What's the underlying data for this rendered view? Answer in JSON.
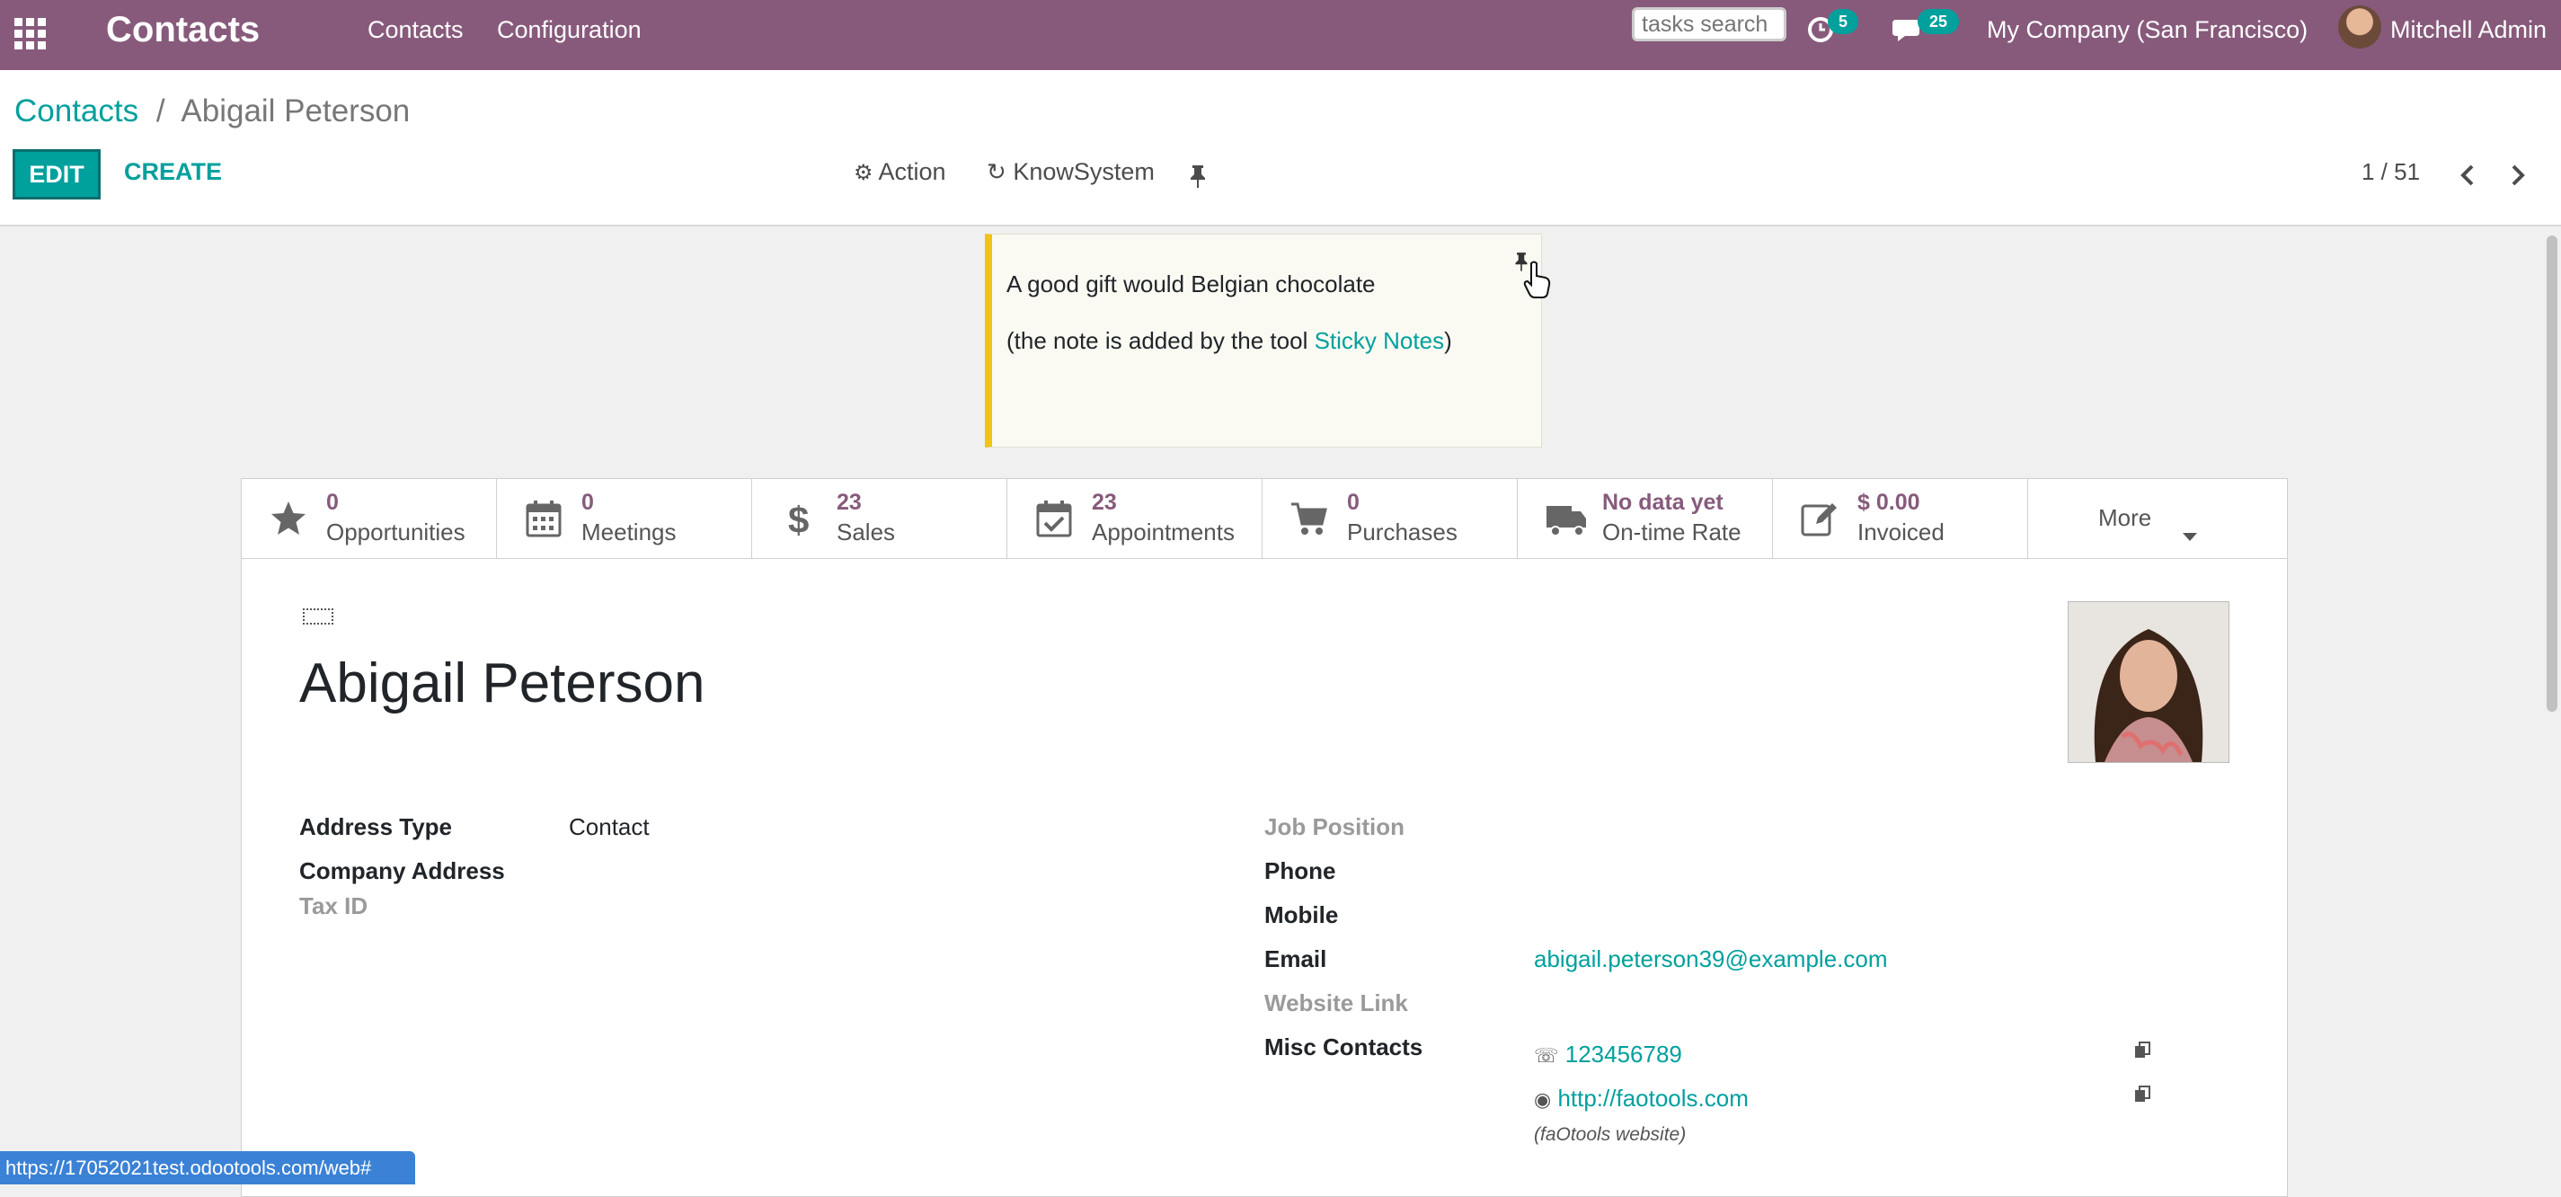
{
  "navbar": {
    "app_title": "Contacts",
    "menu": [
      "Contacts",
      "Configuration"
    ],
    "search_placeholder": "tasks search",
    "activity_count": "5",
    "messages_count": "25",
    "company": "My Company (San Francisco)",
    "user": "Mitchell Admin"
  },
  "breadcrumb": {
    "parent": "Contacts",
    "separator": "/",
    "current": "Abigail Peterson"
  },
  "control_panel": {
    "edit_label": "EDIT",
    "create_label": "CREATE",
    "action_label": "Action",
    "knowsystem_label": "KnowSystem",
    "pager": "1 / 51"
  },
  "sticky_note": {
    "line1": "A good gift would Belgian chocolate",
    "line2_prefix": "(the note is added by the tool ",
    "line2_link": "Sticky Notes",
    "line2_suffix": ")"
  },
  "stat_buttons": [
    {
      "value": "0",
      "label": "Opportunities",
      "icon": "star-icon"
    },
    {
      "value": "0",
      "label": "Meetings",
      "icon": "calendar-icon"
    },
    {
      "value": "23",
      "label": "Sales",
      "icon": "dollar-icon"
    },
    {
      "value": "23",
      "label": "Appointments",
      "icon": "calendar-check-icon"
    },
    {
      "value": "0",
      "label": "Purchases",
      "icon": "cart-icon"
    },
    {
      "value": "No data yet",
      "label": "On-time Rate",
      "icon": "truck-icon"
    },
    {
      "value": "$ 0.00",
      "label": "Invoiced",
      "icon": "edit-icon"
    }
  ],
  "more_label": "More",
  "contact": {
    "name": "Abigail Peterson",
    "left_fields": [
      {
        "label": "Address Type",
        "value": "Contact"
      },
      {
        "label": "Company Address",
        "value": ""
      },
      {
        "label": "Tax ID",
        "value": ""
      }
    ],
    "right_fields": [
      {
        "label": "Job Position",
        "value": ""
      },
      {
        "label": "Phone",
        "value": ""
      },
      {
        "label": "Mobile",
        "value": ""
      },
      {
        "label": "Email",
        "value": "abigail.peterson39@example.com"
      },
      {
        "label": "Website Link",
        "value": ""
      },
      {
        "label": "Misc Contacts",
        "value": ""
      }
    ],
    "misc": [
      {
        "icon": "whatsapp-icon",
        "value": "123456789"
      },
      {
        "icon": "globe-icon",
        "value": "http://faotools.com",
        "note": "(faOtools website)"
      }
    ]
  },
  "status_url": "https://17052021test.odootools.com/web#",
  "colors": {
    "brand": "#875a7b",
    "accent": "#00a09d",
    "note_border": "#f2c215"
  }
}
